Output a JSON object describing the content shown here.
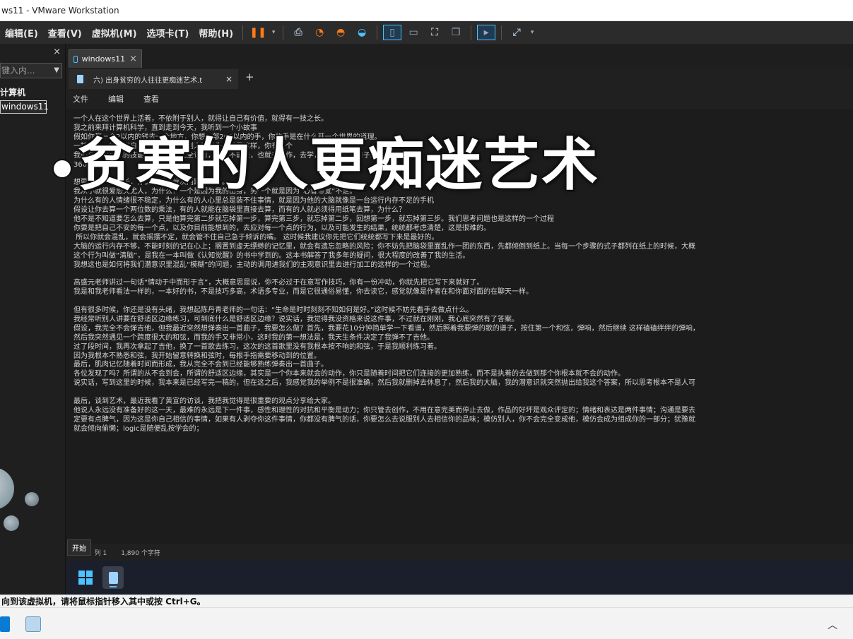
{
  "window": {
    "title": "ws11 - VMware Workstation"
  },
  "menubar": {
    "items": [
      "编辑(E)",
      "查看(V)",
      "虚拟机(M)",
      "选项卡(T)",
      "帮助(H)"
    ],
    "icons": [
      "pause-icon",
      "send-keys-icon",
      "snapshot-icon",
      "revert-icon",
      "manage-snapshot-icon",
      "library-icon",
      "thumbnail-icon",
      "fullscreen-icon",
      "unity-icon",
      "console-icon",
      "stretch-icon"
    ]
  },
  "library": {
    "close": "×",
    "search_placeholder": "键入内...",
    "tree_title": "计算机",
    "tree_item": "windows11"
  },
  "vm_tab": {
    "label": "windows11",
    "close": "×"
  },
  "notepad": {
    "tab_title": "六) 出身贫穷的人往往更痴迷艺术.t",
    "tab_close": "×",
    "new_tab": "+",
    "menu": [
      "文件",
      "编辑",
      "查看"
    ],
    "lines": [
      "一个人在这个世界上活着，不依附于别人，就得让自己有价值，就得有一技之长。",
      "我之前来拜计算机科学，直到走到今天，我听到一个小故事",
      "假如你带一个2以内的钱去一个地方，你想一部200以内的手，你的手是在什么开一个世界的道理。",
      "一技之长，你没有自己的一技，人在别人把握头你就是这样，你有一个",
      "我们总是觉得你的技能没有被别人完全认可，自己不能去，也就去工作，去学，反正这样的日子。",
      "360行，",
      "",
      "想要拥有一技之长，你首先要有解决问题的能力。",
      "我从小就很爱怨天尤人，为什么？一个是因为我的出身，另一个就是因为“心智带宽”不足。",
      "为什么有的人情绪很不稳定，为什么有的人心里总是装不住事情，就是因为他的大脑就像是一台运行内存不足的手机",
      "假设让你去算一个两位数的乘法，有的人就能在脑袋里直接去算，而有的人就必须得用纸笔去算，为什么？",
      "他不是不知道要怎么去算，只是他算完第二步就忘掉第一步，算完第三步，就忘掉第二步，回想第一步，就忘掉第三步。我们思考问题也是这样的一个过程",
      "你要是把自己不安的每一个点，以及你目前能想到的，去应对每一个点的行为，以及可能发生的结果，统统都考虑清楚，这是很难的。",
      " 所以你就会混乱，就会摇摆不定，就会管不住自己急于倾诉的嘴。 这时候我建议你先把它们统统都写下来是最好的。",
      "大脑的运行内存不够，不能时刻的记在心上；搁置到虚无缥缈的记忆里，就会有遗忘忽略的风险；你不妨先把脑袋里面乱作一团的东西，先都倾倒到纸上。当每一个步骤的式子都列在纸上的时候，大概",
      "这个行为叫做“清脑”，是我在一本叫做《认知觉醒》的书中学到的。这本书解答了我多年的疑问，很大程度的改善了我的生活。",
      "我想这也是如何将我们潜意识里混乱“模糊”的问题，主动的调用进我们的主观意识里去进行加工的这样的一个过程。",
      "",
      "高盛元老师讲过一句话“情动于中而形于言”，大概意思是说，你不必过于在意写作技巧，你有一份冲动，你就先把它写下来就好了。",
      "我是和我老师看法一样的，一本好的书，不是技巧多高，术语多专业，而是它很通俗易懂，你去读它，感觉就像是作者在和你面对面的在聊天一样。",
      "",
      "但有很多时候，你还是没有头绪，我想起陈丹青老师的一句话：“生命是时时刻刻不知如何是好。”这时候不妨先看手去做点什么。",
      "我经常听别人讲要在舒适区边缘练习，可到底什么是舒适区边缘？说实话，我觉得我没资格来说这件事，不过就在刚刚，我心底突然有了答案。",
      "假设，我完全不会弹吉他，但我最近突然想弹奏出一首曲子，我要怎么做？首先，我要花10分钟简单学一下看谱，然后照着我要弹的歌的谱子，按住第一个和弦，弹响，然后继续 这样磕磕绊绊的弹响，",
      "然后我突然遇见一个跨度很大的和弦，而我的手又非常小，这时我的第一想法是，我天生条件决定了我弹不了吉他。",
      "过了段时间，我再次拿起了吉他，换了一首歌去练习，这次的这首歌里没有我根本按不响的和弦，于是我顺利练习着。",
      "因为我根本不熟悉和弦，我开始留意转换和弦时，每根手指需要移动到的位置。",
      "最后，肌肉记忆随着时间而形成，我从完全不会到已经能够熟练弹奏出一首曲子。",
      "各位发现了吗？所谓的从不会到会，所谓的舒适区边缘，其实是一个你本来就会的动作，你只是随着时间把它们连接的更加熟练，而不是执着的去做到那个你根本就不会的动作。",
      "说实话，写到这里的时候，我本来是已经写完一稿的，但在这之后，我感觉我的举例不是很准确，然后我就删掉去休息了，然后我的大脑，我的潜意识就突然抛出给我这个答案，所以思考根本不是人可",
      "",
      "最后，谈到艺术，最近我看了黄宣的访谈，我把我觉得是很重要的观点分享给大家。",
      "他说人永远没有准备好的这一天，最难的永远是下一件事，感性和理性的对抗和平衡是动力；你只管去创作，不用在意完美而停止去做，作品的好坏是观众评定的；情绪和表达是两件事情；沟通是要去",
      "定要有点脾气，因为这是你自己相信的事情，如果有人剥夺你这件事情，你都没有脾气的话，你要怎么去说服别人去相信你的品味；模仿别人，你不会完全变成他，模仿会成为组成你的一部分；犹豫就",
      "就会倾向偷懒；logic是随便乱按学会的；"
    ],
    "status": {
      "position": "行 1，列 1",
      "chars": "1,890 个字符"
    },
    "start_tooltip": "开始"
  },
  "overlay_title": "贫寒的人更痴迷艺术",
  "host_status": "向到该虚拟机，请将鼠标指针移入其中或按 Ctrl+G。",
  "colors": {
    "accent": "#ff7a1a",
    "guest_bg": "#1c1c1c",
    "host_bg": "#2b2b2b"
  }
}
